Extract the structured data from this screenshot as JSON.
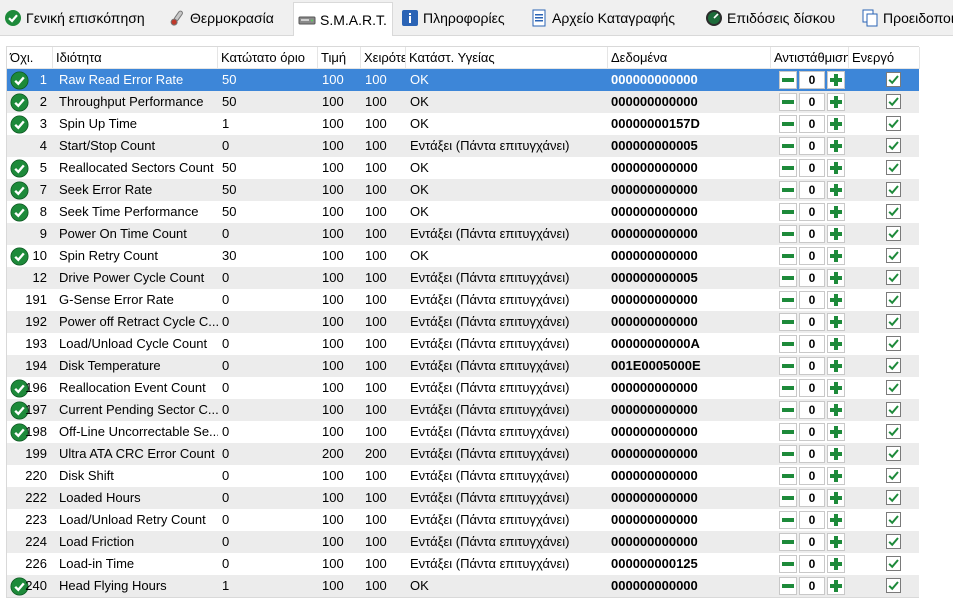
{
  "tabs": [
    {
      "label": "Γενική επισκόπηση",
      "icon": "check-circle-icon"
    },
    {
      "label": "Θερμοκρασία",
      "icon": "thermometer-icon"
    },
    {
      "label": "S.M.A.R.T.",
      "icon": "hard-drive-icon",
      "active": true
    },
    {
      "label": "Πληροφορίες",
      "icon": "info-icon"
    },
    {
      "label": "Αρχείο Καταγραφής",
      "icon": "document-icon"
    },
    {
      "label": "Επιδόσεις δίσκου",
      "icon": "speedometer-icon"
    },
    {
      "label": "Προειδοποιήσεις",
      "icon": "copy-icon"
    }
  ],
  "columns": {
    "id": "Όχι.",
    "name": "Ιδιότητα",
    "low": "Κατώτατο όριο",
    "value": "Τιμή",
    "worst": "Χειρότερη",
    "status": "Κατάστ. Υγείας",
    "data": "Δεδομένα",
    "counter": "Αντιστάθμιση",
    "active": "Ενεργό"
  },
  "colors": {
    "selected_row": "#3d86d8",
    "ok_icon": "#1d8a3a",
    "counter_green": "#1d8a3a",
    "alt_row": "#ececec"
  },
  "rows": [
    {
      "id": "1",
      "name": "Raw Read Error Rate",
      "low": "50",
      "value": "100",
      "worst": "100",
      "status": "OK",
      "data": "000000000000",
      "counter": "0",
      "ok": true,
      "selected": true
    },
    {
      "id": "2",
      "name": "Throughput Performance",
      "low": "50",
      "value": "100",
      "worst": "100",
      "status": "OK",
      "data": "000000000000",
      "counter": "0",
      "ok": true
    },
    {
      "id": "3",
      "name": "Spin Up Time",
      "low": "1",
      "value": "100",
      "worst": "100",
      "status": "OK",
      "data": "00000000157D",
      "counter": "0",
      "ok": true
    },
    {
      "id": "4",
      "name": "Start/Stop Count",
      "low": "0",
      "value": "100",
      "worst": "100",
      "status": "Εντάξει (Πάντα επιτυγχάνει)",
      "data": "000000000005",
      "counter": "0",
      "ok": false
    },
    {
      "id": "5",
      "name": "Reallocated Sectors Count",
      "low": "50",
      "value": "100",
      "worst": "100",
      "status": "OK",
      "data": "000000000000",
      "counter": "0",
      "ok": true
    },
    {
      "id": "7",
      "name": "Seek Error Rate",
      "low": "50",
      "value": "100",
      "worst": "100",
      "status": "OK",
      "data": "000000000000",
      "counter": "0",
      "ok": true
    },
    {
      "id": "8",
      "name": "Seek Time Performance",
      "low": "50",
      "value": "100",
      "worst": "100",
      "status": "OK",
      "data": "000000000000",
      "counter": "0",
      "ok": true
    },
    {
      "id": "9",
      "name": "Power On Time Count",
      "low": "0",
      "value": "100",
      "worst": "100",
      "status": "Εντάξει (Πάντα επιτυγχάνει)",
      "data": "000000000000",
      "counter": "0",
      "ok": false
    },
    {
      "id": "10",
      "name": "Spin Retry Count",
      "low": "30",
      "value": "100",
      "worst": "100",
      "status": "OK",
      "data": "000000000000",
      "counter": "0",
      "ok": true
    },
    {
      "id": "12",
      "name": "Drive Power Cycle Count",
      "low": "0",
      "value": "100",
      "worst": "100",
      "status": "Εντάξει (Πάντα επιτυγχάνει)",
      "data": "000000000005",
      "counter": "0",
      "ok": false
    },
    {
      "id": "191",
      "name": "G-Sense Error Rate",
      "low": "0",
      "value": "100",
      "worst": "100",
      "status": "Εντάξει (Πάντα επιτυγχάνει)",
      "data": "000000000000",
      "counter": "0",
      "ok": false
    },
    {
      "id": "192",
      "name": "Power off Retract Cycle C...",
      "low": "0",
      "value": "100",
      "worst": "100",
      "status": "Εντάξει (Πάντα επιτυγχάνει)",
      "data": "000000000000",
      "counter": "0",
      "ok": false
    },
    {
      "id": "193",
      "name": "Load/Unload Cycle Count",
      "low": "0",
      "value": "100",
      "worst": "100",
      "status": "Εντάξει (Πάντα επιτυγχάνει)",
      "data": "00000000000A",
      "counter": "0",
      "ok": false
    },
    {
      "id": "194",
      "name": "Disk Temperature",
      "low": "0",
      "value": "100",
      "worst": "100",
      "status": "Εντάξει (Πάντα επιτυγχάνει)",
      "data": "001E0005000E",
      "counter": "0",
      "ok": false
    },
    {
      "id": "196",
      "name": "Reallocation Event Count",
      "low": "0",
      "value": "100",
      "worst": "100",
      "status": "Εντάξει (Πάντα επιτυγχάνει)",
      "data": "000000000000",
      "counter": "0",
      "ok": true
    },
    {
      "id": "197",
      "name": "Current Pending Sector C...",
      "low": "0",
      "value": "100",
      "worst": "100",
      "status": "Εντάξει (Πάντα επιτυγχάνει)",
      "data": "000000000000",
      "counter": "0",
      "ok": true
    },
    {
      "id": "198",
      "name": "Off-Line Uncorrectable Se...",
      "low": "0",
      "value": "100",
      "worst": "100",
      "status": "Εντάξει (Πάντα επιτυγχάνει)",
      "data": "000000000000",
      "counter": "0",
      "ok": true
    },
    {
      "id": "199",
      "name": "Ultra ATA CRC Error Count",
      "low": "0",
      "value": "200",
      "worst": "200",
      "status": "Εντάξει (Πάντα επιτυγχάνει)",
      "data": "000000000000",
      "counter": "0",
      "ok": false
    },
    {
      "id": "220",
      "name": "Disk Shift",
      "low": "0",
      "value": "100",
      "worst": "100",
      "status": "Εντάξει (Πάντα επιτυγχάνει)",
      "data": "000000000000",
      "counter": "0",
      "ok": false
    },
    {
      "id": "222",
      "name": "Loaded Hours",
      "low": "0",
      "value": "100",
      "worst": "100",
      "status": "Εντάξει (Πάντα επιτυγχάνει)",
      "data": "000000000000",
      "counter": "0",
      "ok": false
    },
    {
      "id": "223",
      "name": "Load/Unload Retry Count",
      "low": "0",
      "value": "100",
      "worst": "100",
      "status": "Εντάξει (Πάντα επιτυγχάνει)",
      "data": "000000000000",
      "counter": "0",
      "ok": false
    },
    {
      "id": "224",
      "name": "Load Friction",
      "low": "0",
      "value": "100",
      "worst": "100",
      "status": "Εντάξει (Πάντα επιτυγχάνει)",
      "data": "000000000000",
      "counter": "0",
      "ok": false
    },
    {
      "id": "226",
      "name": "Load-in Time",
      "low": "0",
      "value": "100",
      "worst": "100",
      "status": "Εντάξει (Πάντα επιτυγχάνει)",
      "data": "000000000125",
      "counter": "0",
      "ok": false
    },
    {
      "id": "240",
      "name": "Head Flying Hours",
      "low": "1",
      "value": "100",
      "worst": "100",
      "status": "OK",
      "data": "000000000000",
      "counter": "0",
      "ok": true
    }
  ]
}
